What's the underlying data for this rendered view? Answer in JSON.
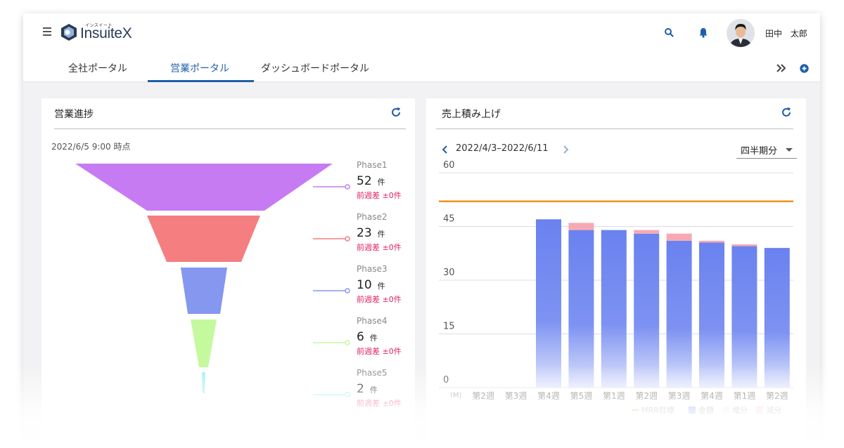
{
  "app": {
    "logo_text": "InsuiteX",
    "logo_ruby": "インスイート",
    "user_name": "田中 太郎"
  },
  "tabs": [
    {
      "label": "全社ポータル",
      "active": false
    },
    {
      "label": "営業ポータル",
      "active": true
    },
    {
      "label": "ダッシュボードポータル",
      "active": false
    }
  ],
  "colors": {
    "accent": "#1f5fa8",
    "diff_red": "#e0245e",
    "target_line": "#f0921e",
    "bar_blue": "#6e86f0",
    "increase_pink": "#f7a9b3"
  },
  "icons": {
    "menu": "hamburger-icon",
    "search": "search-icon",
    "notification": "bell-icon",
    "more": "double-chevron-right-icon",
    "add": "plus-circle-icon",
    "refresh": "refresh-icon"
  },
  "sales_progress": {
    "title": "営業進捗",
    "timestamp": "2022/6/5 9:00 時点",
    "phases": [
      {
        "name": "Phase1",
        "count": "52",
        "unit": "件",
        "diff": "前週差 ±0件",
        "color": "#c77bf2"
      },
      {
        "name": "Phase2",
        "count": "23",
        "unit": "件",
        "diff": "前週差 ±0件",
        "color": "#f47e80"
      },
      {
        "name": "Phase3",
        "count": "10",
        "unit": "件",
        "diff": "前週差 ±0件",
        "color": "#8597ef"
      },
      {
        "name": "Phase4",
        "count": "6",
        "unit": "件",
        "diff": "前週差 ±0件",
        "color": "#c4f99e"
      },
      {
        "name": "Phase5",
        "count": "2",
        "unit": "件",
        "diff": "前週差 ±0件",
        "color": "#9ff1f7"
      }
    ]
  },
  "sales_stack": {
    "title": "売上積み上げ",
    "date_range": "2022/4/3–2022/6/11",
    "period": "四半期分"
  },
  "chart_data": {
    "type": "bar",
    "stacked": true,
    "unit": "(M)",
    "categories": [
      "第2週",
      "第3週",
      "第4週",
      "第5週",
      "第1週",
      "第2週",
      "第3週",
      "第4週",
      "第1週",
      "第2週"
    ],
    "series": [
      {
        "name": "金額",
        "values": [
          0,
          0,
          47,
          44,
          44,
          43,
          41,
          40.5,
          39.5,
          39
        ],
        "color": "#6e86f0"
      },
      {
        "name": "増分",
        "values": [
          0,
          0,
          0,
          2,
          0,
          1,
          2,
          0.5,
          0.5,
          0
        ],
        "color": "#f7a9b3"
      },
      {
        "name": "減分",
        "values": [
          0,
          0,
          0,
          0,
          0,
          0,
          0,
          0,
          0,
          0
        ],
        "color": "#f9c3cb"
      }
    ],
    "target": {
      "name": "MRR目標",
      "value": 52,
      "color": "#f0921e"
    },
    "ylim": [
      0,
      60
    ],
    "yticks": [
      0,
      15,
      30,
      45,
      60
    ],
    "grid": true,
    "legend_position": "bottom-right",
    "legend": [
      "MRR目標",
      "金額",
      "増分",
      "減分"
    ]
  }
}
